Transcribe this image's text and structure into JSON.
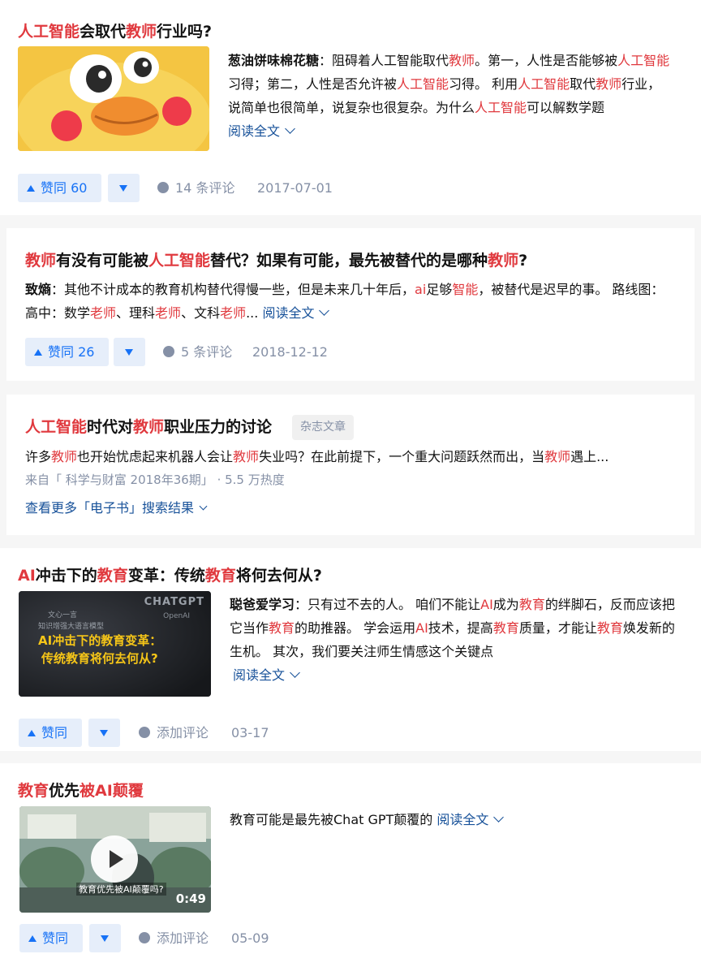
{
  "colors": {
    "highlight": "#e0393e",
    "link": "#175199",
    "vote": "#1772f6",
    "vote_bg": "#e6eefa",
    "meta": "#8590a6"
  },
  "results": [
    {
      "title": [
        {
          "t": "人工智能",
          "h": true
        },
        {
          "t": "会取代",
          "h": false
        },
        {
          "t": "教师",
          "h": true
        },
        {
          "t": "行业吗?",
          "h": false
        }
      ],
      "author": "葱油饼味棉花糖",
      "excerpt": [
        {
          "t": "阻碍着人工智能取代",
          "h": false
        },
        {
          "t": "教师",
          "h": true
        },
        {
          "t": "。第一，人性是否能够被",
          "h": false
        },
        {
          "t": "人工智能",
          "h": true
        },
        {
          "t": "习得；第二，人性是否允许被",
          "h": false
        },
        {
          "t": "人工智能",
          "h": true
        },
        {
          "t": "习得。 利用",
          "h": false
        },
        {
          "t": "人工智能",
          "h": true
        },
        {
          "t": "取代",
          "h": false
        },
        {
          "t": "教师",
          "h": true
        },
        {
          "t": "行业，说简单也很简单，说复杂也很复杂。为什么",
          "h": false
        },
        {
          "t": "人工智能",
          "h": true
        },
        {
          "t": "可以解数学题",
          "h": false
        }
      ],
      "read_more": "阅读全文",
      "upvote": "赞同 60",
      "comments": "14 条评论",
      "date": "2017-07-01"
    },
    {
      "title": [
        {
          "t": "教师",
          "h": true
        },
        {
          "t": "有没有可能被",
          "h": false
        },
        {
          "t": "人工智能",
          "h": true
        },
        {
          "t": "替代？如果有可能，最先被替代的是哪种",
          "h": false
        },
        {
          "t": "教师",
          "h": true
        },
        {
          "t": "?",
          "h": false
        }
      ],
      "author": "致熵",
      "excerpt": [
        {
          "t": "其他不计成本的教育机构替代得慢一些，但是未来几十年后，",
          "h": false
        },
        {
          "t": "ai",
          "h": true
        },
        {
          "t": "足够",
          "h": false
        },
        {
          "t": "智能",
          "h": true
        },
        {
          "t": "，被替代是迟早的事。 路线图： 高中：数学",
          "h": false
        },
        {
          "t": "老师",
          "h": true
        },
        {
          "t": "、理科",
          "h": false
        },
        {
          "t": "老师",
          "h": true
        },
        {
          "t": "、文科",
          "h": false
        },
        {
          "t": "老师",
          "h": true
        },
        {
          "t": "...",
          "h": false
        }
      ],
      "read_more": "阅读全文",
      "upvote": "赞同 26",
      "comments": "5 条评论",
      "date": "2018-12-12"
    },
    {
      "title": [
        {
          "t": "人工智能",
          "h": true
        },
        {
          "t": "时代对",
          "h": false
        },
        {
          "t": "教师",
          "h": true
        },
        {
          "t": "职业压力的讨论",
          "h": false
        }
      ],
      "tag": "杂志文章",
      "excerpt": [
        {
          "t": "许多",
          "h": false
        },
        {
          "t": "教师",
          "h": true
        },
        {
          "t": "也开始忧虑起来机器人会让",
          "h": false
        },
        {
          "t": "教师",
          "h": true
        },
        {
          "t": "失业吗？在此前提下，一个重大问题跃然而出，当",
          "h": false
        },
        {
          "t": "教师",
          "h": true
        },
        {
          "t": "遇上...",
          "h": false
        }
      ],
      "source": "来自「 科学与财富 2018年36期」 · 5.5 万热度",
      "more_link": "查看更多「电子书」搜索结果"
    },
    {
      "title": [
        {
          "t": "AI",
          "h": true
        },
        {
          "t": "冲击下的",
          "h": false
        },
        {
          "t": "教育",
          "h": true
        },
        {
          "t": "变革：传统",
          "h": false
        },
        {
          "t": "教育",
          "h": true
        },
        {
          "t": "将何去何从?",
          "h": false
        }
      ],
      "author": "聪爸爱学习",
      "excerpt": [
        {
          "t": "只有过不去的人。 咱们不能让",
          "h": false
        },
        {
          "t": "AI",
          "h": true
        },
        {
          "t": "成为",
          "h": false
        },
        {
          "t": "教育",
          "h": true
        },
        {
          "t": "的绊脚石，反而应该把它当作",
          "h": false
        },
        {
          "t": "教育",
          "h": true
        },
        {
          "t": "的助推器。 学会运用",
          "h": false
        },
        {
          "t": "AI",
          "h": true
        },
        {
          "t": "技术，提高",
          "h": false
        },
        {
          "t": "教育",
          "h": true
        },
        {
          "t": "质量，才能让",
          "h": false
        },
        {
          "t": "教育",
          "h": true
        },
        {
          "t": "焕发新的生机。 其次，我们要关注师生情感这个关键点",
          "h": false
        }
      ],
      "read_more": "阅读全文",
      "thumb": {
        "brand": "CHATGPT",
        "brand_sub": "OpenAI",
        "line0": "文心一言",
        "line1": "知识增强大语言模型",
        "line2": "AI冲击下的教育变革：",
        "line3": "传统教育将何去何从?"
      },
      "upvote": "赞同",
      "comments": "添加评论",
      "date": "03-17"
    },
    {
      "title": [
        {
          "t": "教育",
          "h": true
        },
        {
          "t": "优先",
          "h": false
        },
        {
          "t": "被",
          "h": true
        },
        {
          "t": "AI",
          "h": true
        },
        {
          "t": "颠覆",
          "h": true
        }
      ],
      "excerpt_plain": "教育可能是最先被Chat GPT颠覆的",
      "read_more": "阅读全文",
      "video": {
        "duration": "0:49",
        "caption": "教育优先被AI颠覆吗?"
      },
      "upvote": "赞同",
      "comments": "添加评论",
      "date": "05-09"
    }
  ]
}
